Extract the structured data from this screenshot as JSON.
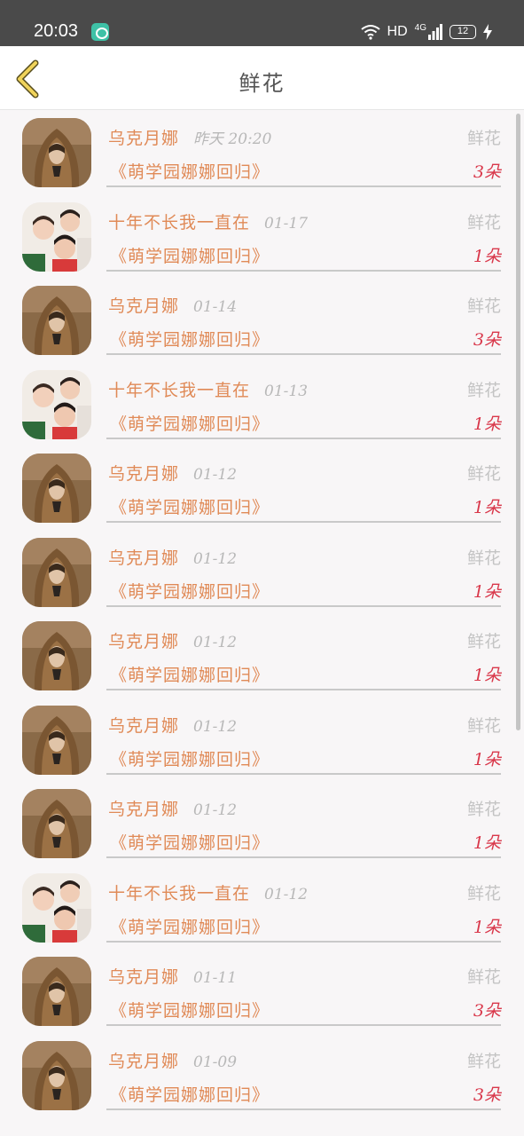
{
  "status_bar": {
    "time": "20:03",
    "network_type": "HD",
    "network_gen": "4G",
    "battery": "12"
  },
  "header": {
    "title": "鲜花",
    "back_icon": "chevron-left-icon"
  },
  "colors": {
    "accent": "#e08a57",
    "count": "#d9374a",
    "muted": "#c4c4c4",
    "back_icon": "#f0d35a"
  },
  "rows": [
    {
      "name": "乌克月娜",
      "date": "昨天 20:20",
      "type": "鲜花",
      "book": "《萌学园娜娜回归》",
      "count": "3朵",
      "avatar": "hooded-person"
    },
    {
      "name": "十年不长我一直在",
      "date": "01-17",
      "type": "鲜花",
      "book": "《萌学园娜娜回归》",
      "count": "1朵",
      "avatar": "group-photo"
    },
    {
      "name": "乌克月娜",
      "date": "01-14",
      "type": "鲜花",
      "book": "《萌学园娜娜回归》",
      "count": "3朵",
      "avatar": "hooded-person"
    },
    {
      "name": "十年不长我一直在",
      "date": "01-13",
      "type": "鲜花",
      "book": "《萌学园娜娜回归》",
      "count": "1朵",
      "avatar": "group-photo"
    },
    {
      "name": "乌克月娜",
      "date": "01-12",
      "type": "鲜花",
      "book": "《萌学园娜娜回归》",
      "count": "1朵",
      "avatar": "hooded-person"
    },
    {
      "name": "乌克月娜",
      "date": "01-12",
      "type": "鲜花",
      "book": "《萌学园娜娜回归》",
      "count": "1朵",
      "avatar": "hooded-person"
    },
    {
      "name": "乌克月娜",
      "date": "01-12",
      "type": "鲜花",
      "book": "《萌学园娜娜回归》",
      "count": "1朵",
      "avatar": "hooded-person"
    },
    {
      "name": "乌克月娜",
      "date": "01-12",
      "type": "鲜花",
      "book": "《萌学园娜娜回归》",
      "count": "1朵",
      "avatar": "hooded-person"
    },
    {
      "name": "乌克月娜",
      "date": "01-12",
      "type": "鲜花",
      "book": "《萌学园娜娜回归》",
      "count": "1朵",
      "avatar": "hooded-person"
    },
    {
      "name": "十年不长我一直在",
      "date": "01-12",
      "type": "鲜花",
      "book": "《萌学园娜娜回归》",
      "count": "1朵",
      "avatar": "group-photo"
    },
    {
      "name": "乌克月娜",
      "date": "01-11",
      "type": "鲜花",
      "book": "《萌学园娜娜回归》",
      "count": "3朵",
      "avatar": "hooded-person"
    },
    {
      "name": "乌克月娜",
      "date": "01-09",
      "type": "鲜花",
      "book": "《萌学园娜娜回归》",
      "count": "3朵",
      "avatar": "hooded-person"
    }
  ]
}
